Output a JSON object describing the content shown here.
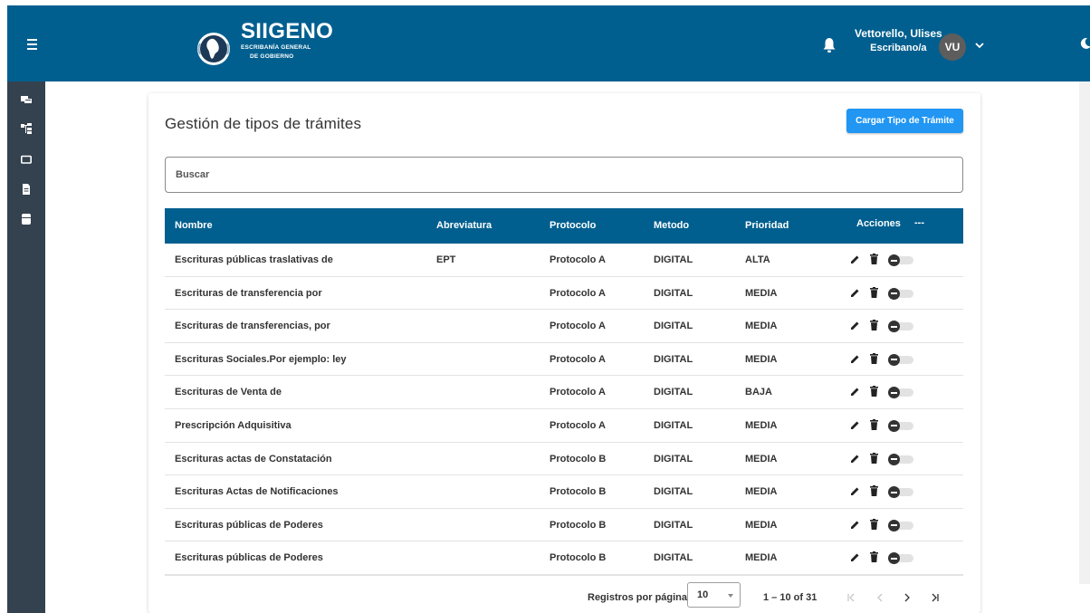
{
  "header": {
    "brand_title": "SIIGENO",
    "brand_sub_line1": "ESCRIBANÍA GENERAL",
    "brand_sub_line2": "DE GOBIERNO",
    "user_name": "Vettorello, Ulises",
    "user_role": "Escribano/a",
    "avatar_initials": "VU",
    "icons": [
      "menu-icon",
      "logo",
      "bell-icon",
      "chevron-down-icon",
      "moon-icon"
    ]
  },
  "sidebar": {
    "items": [
      {
        "icon": "inbox-icon"
      },
      {
        "icon": "sitemap-icon"
      },
      {
        "icon": "folder-icon"
      },
      {
        "icon": "document-icon"
      },
      {
        "icon": "database-icon"
      }
    ]
  },
  "main": {
    "title": "Gestión de tipos de trámites",
    "primary_button": "Cargar Tipo de Trámite",
    "search_placeholder": "Buscar"
  },
  "table": {
    "columns": {
      "nombre": "Nombre",
      "abreviatura": "Abreviatura",
      "protocolo": "Protocolo",
      "metodo": "Metodo",
      "prioridad": "Prioridad",
      "acciones": "Acciones",
      "more": "---"
    },
    "rows": [
      {
        "nombre": "Escrituras públicas traslativas de",
        "abreviatura": "EPT",
        "protocolo": "Protocolo A",
        "metodo": "DIGITAL",
        "prioridad": "ALTA"
      },
      {
        "nombre": "Escrituras de transferencia por",
        "abreviatura": "",
        "protocolo": "Protocolo A",
        "metodo": "DIGITAL",
        "prioridad": "MEDIA"
      },
      {
        "nombre": "Escrituras de transferencias, por",
        "abreviatura": "",
        "protocolo": "Protocolo A",
        "metodo": "DIGITAL",
        "prioridad": "MEDIA"
      },
      {
        "nombre": "Escrituras Sociales.Por ejemplo: ley",
        "abreviatura": "",
        "protocolo": "Protocolo A",
        "metodo": "DIGITAL",
        "prioridad": "MEDIA"
      },
      {
        "nombre": "Escrituras de Venta de",
        "abreviatura": "",
        "protocolo": "Protocolo A",
        "metodo": "DIGITAL",
        "prioridad": "BAJA"
      },
      {
        "nombre": "Prescripción Adquisitiva",
        "abreviatura": "",
        "protocolo": "Protocolo A",
        "metodo": "DIGITAL",
        "prioridad": "MEDIA"
      },
      {
        "nombre": "Escrituras actas de Constatación",
        "abreviatura": "",
        "protocolo": "Protocolo B",
        "metodo": "DIGITAL",
        "prioridad": "MEDIA"
      },
      {
        "nombre": "Escrituras Actas de Notificaciones",
        "abreviatura": "",
        "protocolo": "Protocolo B",
        "metodo": "DIGITAL",
        "prioridad": "MEDIA"
      },
      {
        "nombre": "Escrituras públicas de Poderes",
        "abreviatura": "",
        "protocolo": "Protocolo B",
        "metodo": "DIGITAL",
        "prioridad": "MEDIA"
      },
      {
        "nombre": "Escrituras públicas de Poderes",
        "abreviatura": "",
        "protocolo": "Protocolo B",
        "metodo": "DIGITAL",
        "prioridad": "MEDIA"
      }
    ],
    "row_actions": [
      "edit-icon",
      "delete-icon",
      "active-toggle"
    ],
    "toggle_state": "off"
  },
  "paginator": {
    "label": "Registros por página",
    "page_size": "10",
    "range": "1 – 10 of 31"
  },
  "colors": {
    "header": "#005f8f",
    "sidebar": "#34414e",
    "primary": "#2196f3"
  }
}
